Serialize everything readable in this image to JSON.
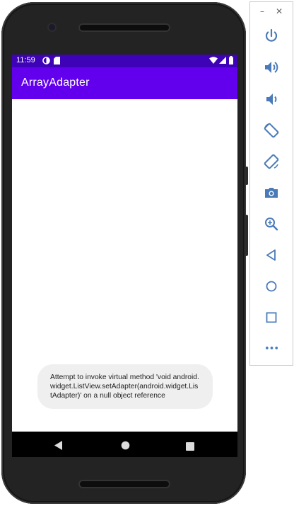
{
  "status_bar": {
    "time": "11:59",
    "background": "#3e02b7"
  },
  "app_bar": {
    "title": "ArrayAdapter",
    "background": "#6200ee"
  },
  "toast": {
    "message": "Attempt to invoke virtual method 'void android.widget.ListView.setAdapter(android.widget.ListAdapter)' on a null object reference"
  },
  "nav_bar": {
    "buttons": [
      "back-icon",
      "home-icon",
      "recents-icon"
    ]
  },
  "emulator_toolbar": {
    "window_controls": [
      "minimize",
      "close"
    ],
    "minimize_symbol": "–",
    "close_symbol": "✕",
    "items": [
      "power",
      "volume-up",
      "volume-down",
      "rotate-left",
      "rotate-right",
      "screenshot",
      "zoom",
      "back",
      "home",
      "overview",
      "more"
    ],
    "more_symbol": "•••",
    "icon_color": "#4a7ab8"
  }
}
